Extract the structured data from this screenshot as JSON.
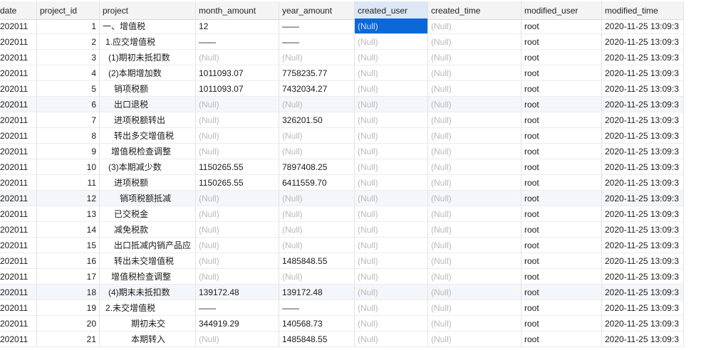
{
  "columns": [
    "date",
    "project_id",
    "project",
    "month_amount",
    "year_amount",
    "created_user",
    "created_time",
    "modified_user",
    "modified_time"
  ],
  "null_text": "(Null)",
  "rows": [
    {
      "date": "202011",
      "project_id": "1",
      "project": "一、增值税",
      "indent": 0,
      "month_amount": "12",
      "year_amount": "——",
      "created_user": null,
      "created_time": null,
      "modified_user": "root",
      "modified_time": "2020-11-25 13:09:3"
    },
    {
      "date": "202011",
      "project_id": "2",
      "project": "1.应交增值税",
      "indent": 1,
      "month_amount": "——",
      "year_amount": "——",
      "created_user": null,
      "created_time": null,
      "modified_user": "root",
      "modified_time": "2020-11-25 13:09:3"
    },
    {
      "date": "202011",
      "project_id": "3",
      "project": "(1)期初未抵扣数",
      "indent": 2,
      "month_amount": null,
      "year_amount": null,
      "created_user": null,
      "created_time": null,
      "modified_user": "root",
      "modified_time": "2020-11-25 13:09:3"
    },
    {
      "date": "202011",
      "project_id": "4",
      "project": "(2)本期增加数",
      "indent": 2,
      "month_amount": "1011093.07",
      "year_amount": "7758235.77",
      "created_user": null,
      "created_time": null,
      "modified_user": "root",
      "modified_time": "2020-11-25 13:09:3"
    },
    {
      "date": "202011",
      "project_id": "5",
      "project": "销项税额",
      "indent": 4,
      "month_amount": "1011093.07",
      "year_amount": "7432034.27",
      "created_user": null,
      "created_time": null,
      "modified_user": "root",
      "modified_time": "2020-11-25 13:09:3"
    },
    {
      "date": "202011",
      "project_id": "6",
      "project": "出口退税",
      "indent": 4,
      "month_amount": null,
      "year_amount": null,
      "created_user": null,
      "created_time": null,
      "modified_user": "root",
      "modified_time": "2020-11-25 13:09:3"
    },
    {
      "date": "202011",
      "project_id": "7",
      "project": "进项税额转出",
      "indent": 4,
      "month_amount": null,
      "year_amount": "326201.50",
      "created_user": null,
      "created_time": null,
      "modified_user": "root",
      "modified_time": "2020-11-25 13:09:3"
    },
    {
      "date": "202011",
      "project_id": "8",
      "project": "转出多交增值税",
      "indent": 4,
      "month_amount": null,
      "year_amount": null,
      "created_user": null,
      "created_time": null,
      "modified_user": "root",
      "modified_time": "2020-11-25 13:09:3"
    },
    {
      "date": "202011",
      "project_id": "9",
      "project": "增值税检查调整",
      "indent": 3,
      "month_amount": null,
      "year_amount": null,
      "created_user": null,
      "created_time": null,
      "modified_user": "root",
      "modified_time": "2020-11-25 13:09:3"
    },
    {
      "date": "202011",
      "project_id": "10",
      "project": "(3)本期减少数",
      "indent": 2,
      "month_amount": "1150265.55",
      "year_amount": "7897408.25",
      "created_user": null,
      "created_time": null,
      "modified_user": "root",
      "modified_time": "2020-11-25 13:09:3"
    },
    {
      "date": "202011",
      "project_id": "11",
      "project": "进项税额",
      "indent": 4,
      "month_amount": "1150265.55",
      "year_amount": "6411559.70",
      "created_user": null,
      "created_time": null,
      "modified_user": "root",
      "modified_time": "2020-11-25 13:09:3"
    },
    {
      "date": "202011",
      "project_id": "12",
      "project": "销项税额抵减",
      "indent": 6,
      "month_amount": null,
      "year_amount": null,
      "created_user": null,
      "created_time": null,
      "modified_user": "root",
      "modified_time": "2020-11-25 13:09:3"
    },
    {
      "date": "202011",
      "project_id": "13",
      "project": "已交税金",
      "indent": 4,
      "month_amount": null,
      "year_amount": null,
      "created_user": null,
      "created_time": null,
      "modified_user": "root",
      "modified_time": "2020-11-25 13:09:3"
    },
    {
      "date": "202011",
      "project_id": "14",
      "project": "减免税款",
      "indent": 4,
      "month_amount": null,
      "year_amount": null,
      "created_user": null,
      "created_time": null,
      "modified_user": "root",
      "modified_time": "2020-11-25 13:09:3"
    },
    {
      "date": "202011",
      "project_id": "15",
      "project": "出口抵减内销产品应",
      "indent": 4,
      "month_amount": null,
      "year_amount": null,
      "created_user": null,
      "created_time": null,
      "modified_user": "root",
      "modified_time": "2020-11-25 13:09:3"
    },
    {
      "date": "202011",
      "project_id": "16",
      "project": "转出未交增值税",
      "indent": 4,
      "month_amount": null,
      "year_amount": "1485848.55",
      "created_user": null,
      "created_time": null,
      "modified_user": "root",
      "modified_time": "2020-11-25 13:09:3"
    },
    {
      "date": "202011",
      "project_id": "17",
      "project": "增值税检查调整",
      "indent": 3,
      "month_amount": null,
      "year_amount": null,
      "created_user": null,
      "created_time": null,
      "modified_user": "root",
      "modified_time": "2020-11-25 13:09:3"
    },
    {
      "date": "202011",
      "project_id": "18",
      "project": "(4)期末未抵扣数",
      "indent": 2,
      "month_amount": "139172.48",
      "year_amount": "139172.48",
      "created_user": null,
      "created_time": null,
      "modified_user": "root",
      "modified_time": "2020-11-25 13:09:3"
    },
    {
      "date": "202011",
      "project_id": "19",
      "project": "2.未交增值税",
      "indent": 1,
      "month_amount": "——",
      "year_amount": "——",
      "created_user": null,
      "created_time": null,
      "modified_user": "root",
      "modified_time": "2020-11-25 13:09:3"
    },
    {
      "date": "202011",
      "project_id": "20",
      "project": "期初未交",
      "indent": 10,
      "month_amount": "344919.29",
      "year_amount": "140568.73",
      "created_user": null,
      "created_time": null,
      "modified_user": "root",
      "modified_time": "2020-11-25 13:09:3"
    },
    {
      "date": "202011",
      "project_id": "21",
      "project": "本期转入",
      "indent": 10,
      "month_amount": null,
      "year_amount": "1485848.55",
      "created_user": null,
      "created_time": null,
      "modified_user": "root",
      "modified_time": "2020-11-25 13:09:3"
    }
  ]
}
